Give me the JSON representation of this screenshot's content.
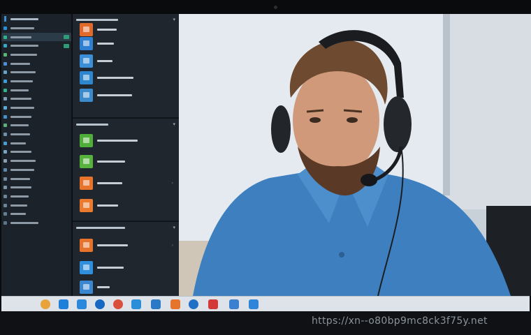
{
  "sidebar": {
    "items": [
      {
        "icon": "folder-icon",
        "color": "#2a8fd6"
      },
      {
        "icon": "chat-icon",
        "color": "#2fb38b"
      },
      {
        "icon": "calendar-icon",
        "color": "#3aa7c9"
      },
      {
        "icon": "document-icon",
        "color": "#5bb56e"
      },
      {
        "icon": "user-icon",
        "color": "#4f8fd1"
      },
      {
        "icon": "settings-icon",
        "color": "#6aa0c4"
      },
      {
        "icon": "mail-icon",
        "color": "#3b9ed8"
      },
      {
        "icon": "phone-icon",
        "color": "#35b190"
      },
      {
        "icon": "list-icon",
        "color": "#7d9bb3"
      },
      {
        "icon": "star-icon",
        "color": "#5fa9d8"
      },
      {
        "icon": "cloud-icon",
        "color": "#4a90c8"
      },
      {
        "icon": "chart-icon",
        "color": "#5fb07a"
      },
      {
        "icon": "note-icon",
        "color": "#6d8ea8"
      },
      {
        "icon": "bell-icon",
        "color": "#4c9bd0"
      },
      {
        "icon": "tag-icon",
        "color": "#77a5c2"
      },
      {
        "icon": "share-icon",
        "color": "#8aa0b2"
      },
      {
        "icon": "grid-icon",
        "color": "#5e87a8"
      },
      {
        "icon": "lock-icon",
        "color": "#6f8aa1"
      },
      {
        "icon": "help-icon",
        "color": "#7a93a8"
      },
      {
        "icon": "info-icon",
        "color": "#6c8599"
      },
      {
        "icon": "folder-icon",
        "color": "#6b8498"
      },
      {
        "icon": "user-icon",
        "color": "#657e92"
      },
      {
        "icon": "settings-icon",
        "color": "#5c7487"
      }
    ]
  },
  "midpanel": {
    "sections": [
      {
        "rows": [
          {
            "icon": "app-icon",
            "color": "#e06a2b"
          },
          {
            "icon": "app-icon",
            "color": "#2f7fd0"
          },
          {
            "icon": "app-icon",
            "color": "#3b8fd6"
          },
          {
            "icon": "app-icon",
            "color": "#2e86cf"
          },
          {
            "icon": "app-icon",
            "color": "#3d8acb"
          }
        ]
      },
      {
        "rows": [
          {
            "icon": "app-icon",
            "color": "#4fae3a"
          },
          {
            "icon": "app-icon",
            "color": "#58b23e"
          },
          {
            "icon": "app-icon",
            "color": "#e8742c"
          },
          {
            "icon": "app-icon",
            "color": "#ec7a2e"
          }
        ]
      },
      {
        "rows": [
          {
            "icon": "app-icon",
            "color": "#e6722b"
          },
          {
            "icon": "app-icon",
            "color": "#2f8fdc"
          },
          {
            "icon": "app-icon",
            "color": "#3a86d0"
          }
        ]
      }
    ]
  },
  "video": {
    "participant": "person-with-headset"
  },
  "taskbar": {
    "items": [
      {
        "icon": "chrome-icon",
        "color": "#e8a33a"
      },
      {
        "icon": "plus-icon",
        "color": "#1e7fd8"
      },
      {
        "icon": "window-icon",
        "color": "#2b88da"
      },
      {
        "icon": "globe-icon",
        "color": "#1769c2"
      },
      {
        "icon": "chrome-icon",
        "color": "#d94f3c"
      },
      {
        "icon": "window-icon",
        "color": "#2c8ed8"
      },
      {
        "icon": "window-icon",
        "color": "#2a78c6"
      },
      {
        "icon": "photo-icon",
        "color": "#e5742c"
      },
      {
        "icon": "globe-icon",
        "color": "#1f6fc6"
      },
      {
        "icon": "video-icon",
        "color": "#d23a3a"
      },
      {
        "icon": "mail-icon",
        "color": "#3b7fcf"
      },
      {
        "icon": "chat-icon",
        "color": "#2f86d8"
      }
    ]
  },
  "watermark": {
    "text": "https://xn--o80bp9mc8ck3f75y.net"
  }
}
